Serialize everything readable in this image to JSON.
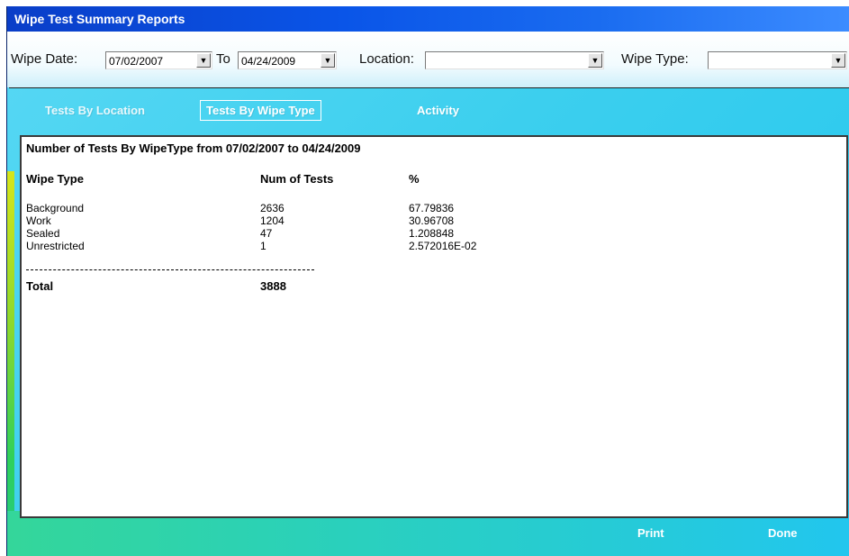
{
  "window": {
    "title": "Wipe Test Summary Reports"
  },
  "filters": {
    "wipe_date_label": "Wipe Date:",
    "date_from": "07/02/2007",
    "to_label": "To",
    "date_to": "04/24/2009",
    "location_label": "Location:",
    "location_value": "",
    "wipe_type_label": "Wipe Type:",
    "wipe_type_value": ""
  },
  "tabs": [
    {
      "label": "Tests By Location"
    },
    {
      "label": "Tests By Wipe Type",
      "active": true
    },
    {
      "label": "Activity"
    }
  ],
  "report": {
    "title": "Number of Tests By WipeType from 07/02/2007 to 04/24/2009",
    "columns": [
      "Wipe Type",
      "Num of Tests",
      "%"
    ],
    "rows": [
      [
        "Background",
        "2636",
        "67.79836"
      ],
      [
        "Work",
        "1204",
        "30.96708"
      ],
      [
        "Sealed",
        "47",
        "1.208848"
      ],
      [
        "Unrestricted",
        "1",
        "2.572016E-02"
      ]
    ],
    "total_label": "Total",
    "total_value": "3888"
  },
  "actions": {
    "print_label": "Print",
    "done_label": "Done"
  },
  "icons": {
    "dropdown": "chevron-down-icon"
  },
  "colors": {
    "title_bar": "#0a55e8",
    "accent": "#22c6ee"
  }
}
